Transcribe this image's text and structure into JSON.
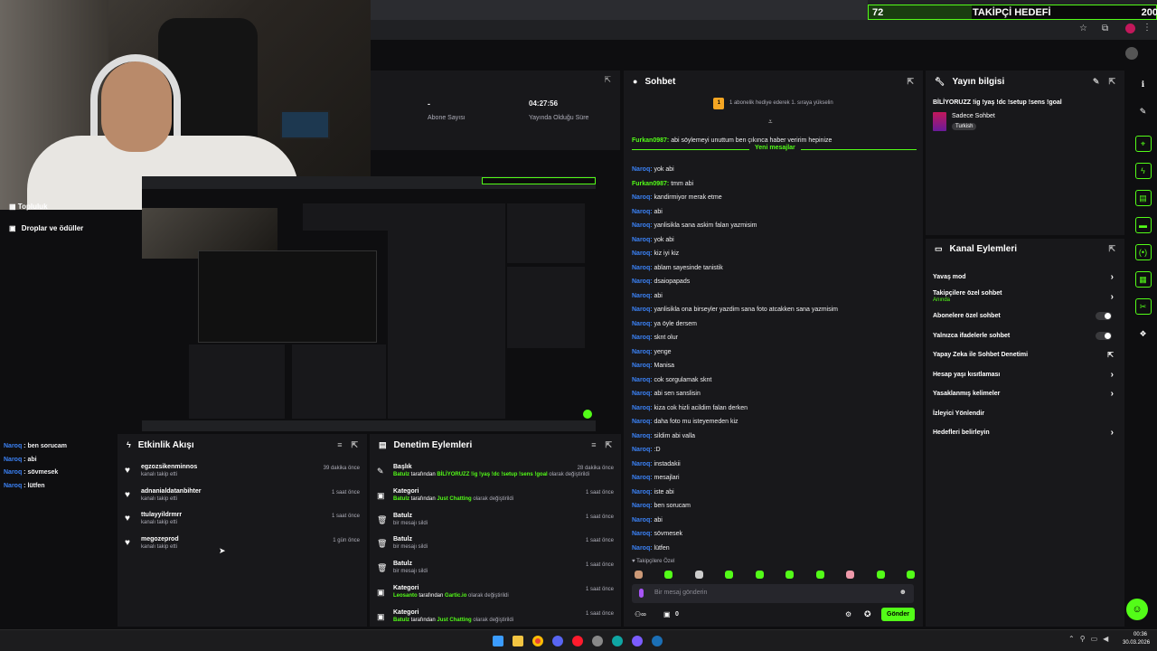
{
  "browser": {
    "progress_left": "72",
    "progress_title": "TAKİPÇİ HEDEFİ",
    "progress_right": "200",
    "progress_fraction": 0.36
  },
  "stats": {
    "dash": "-",
    "subscribers_label": "Abone Sayısı",
    "duration_value": "04:27:56",
    "duration_label": "Yayında Olduğu Süre"
  },
  "left_nav": {
    "item_partial": "Topluluk",
    "drops_label": "Droplar ve ödüller"
  },
  "overlay_chat": [
    {
      "user": "Naroq",
      "text": " : ben sorucam"
    },
    {
      "user": "Naroq",
      "text": " : abi"
    },
    {
      "user": "Naroq",
      "text": " : sövmesek"
    },
    {
      "user": "Naroq",
      "text": " : lütfen"
    }
  ],
  "chat": {
    "title": "Sohbet",
    "banner": "1 abonelik hediye ederek 1. sıraya yükselin",
    "banner_badge": "1",
    "pinned_user": "Furkan0987:",
    "pinned_text": " abi söylemeyi unuttum ben çıkınca haber veririm hepinize",
    "new_messages": "Yeni mesajlar",
    "messages": [
      {
        "user": "Naroq:",
        "text": " yok abi",
        "color": "blue"
      },
      {
        "user": "Furkan0987:",
        "text": " tmm abi",
        "color": "green"
      },
      {
        "user": "Naroq:",
        "text": " kandirmiyor merak etme",
        "color": "blue"
      },
      {
        "user": "Naroq:",
        "text": " abi",
        "color": "blue"
      },
      {
        "user": "Naroq:",
        "text": " yanlisikla sana askim falan yazmisim",
        "color": "blue"
      },
      {
        "user": "Naroq:",
        "text": " yok abi",
        "color": "blue"
      },
      {
        "user": "Naroq:",
        "text": " kiz iyi kiz",
        "color": "blue"
      },
      {
        "user": "Naroq:",
        "text": " ablam sayesinde tanistik",
        "color": "blue"
      },
      {
        "user": "Naroq:",
        "text": " dsaiopapads",
        "color": "blue"
      },
      {
        "user": "Naroq:",
        "text": " abi",
        "color": "blue"
      },
      {
        "user": "Naroq:",
        "text": " yanlisikla ona birseyler yazdim sana foto atcakken sana yazmisim",
        "color": "blue"
      },
      {
        "user": "Naroq:",
        "text": " ya öyle dersem",
        "color": "blue"
      },
      {
        "user": "Naroq:",
        "text": " sknt olur",
        "color": "blue"
      },
      {
        "user": "Naroq:",
        "text": " yenge",
        "color": "blue"
      },
      {
        "user": "Naroq:",
        "text": " Manisa",
        "color": "blue"
      },
      {
        "user": "Naroq:",
        "text": " cok sorgulamak sknt",
        "color": "blue"
      },
      {
        "user": "Naroq:",
        "text": " abi sen sanslisin",
        "color": "blue"
      },
      {
        "user": "Naroq:",
        "text": " kiza cok hizli acildim falan derken",
        "color": "blue"
      },
      {
        "user": "Naroq:",
        "text": " daha foto mu isteyemeden kiz",
        "color": "blue"
      },
      {
        "user": "Naroq:",
        "text": " sildim abi valla",
        "color": "blue"
      },
      {
        "user": "Naroq:",
        "text": " :D",
        "color": "blue"
      },
      {
        "user": "Naroq:",
        "text": " instadakii",
        "color": "blue"
      },
      {
        "user": "Naroq:",
        "text": " mesajlari",
        "color": "blue"
      },
      {
        "user": "Naroq:",
        "text": " iste abi",
        "color": "blue"
      },
      {
        "user": "Naroq:",
        "text": " ben sorucam",
        "color": "blue"
      },
      {
        "user": "Naroq:",
        "text": " abi",
        "color": "blue"
      },
      {
        "user": "Naroq:",
        "text": " sövmesek",
        "color": "blue"
      },
      {
        "user": "Naroq:",
        "text": " lütfen",
        "color": "blue"
      }
    ],
    "followers_only": "Takipçilere Özel",
    "input_placeholder": "Bir mesaj gönderin",
    "count": "0",
    "send_label": "Gönder"
  },
  "stream_info": {
    "title": "Yayın bilgisi",
    "stream_title": "BİLİYORUZZ !ig !yaş !dc !setup !sens !goal",
    "category": "Sadece Sohbet",
    "language": "Turkish"
  },
  "channel_actions": {
    "title": "Kanal Eylemleri",
    "items": [
      {
        "label": "Yavaş mod",
        "control": "chevron",
        "sub": ""
      },
      {
        "label": "Takipçilere özel sohbet",
        "control": "chevron",
        "sub": "Anında"
      },
      {
        "label": "Abonelere özel sohbet",
        "control": "toggle",
        "sub": ""
      },
      {
        "label": "Yalnızca ifadelerle sohbet",
        "control": "toggle",
        "sub": ""
      },
      {
        "label": "Yapay Zeka ile Sohbet Denetimi",
        "control": "external",
        "sub": ""
      },
      {
        "label": "Hesap yaşı kısıtlaması",
        "control": "chevron",
        "sub": ""
      },
      {
        "label": "Yasaklanmış kelimeler",
        "control": "chevron",
        "sub": ""
      },
      {
        "label": "İzleyici Yönlendir",
        "control": "none",
        "sub": ""
      },
      {
        "label": "Hedefleri belirleyin",
        "control": "chevron",
        "sub": ""
      }
    ]
  },
  "activity": {
    "title": "Etkinlik Akışı",
    "items": [
      {
        "name": "egzozsikenminnos",
        "desc": "kanalı takip etti",
        "time": "39 dakika önce"
      },
      {
        "name": "adnanialdatanbihter",
        "desc": "kanalı takip etti",
        "time": "1 saat önce"
      },
      {
        "name": "ttulayyildrmrr",
        "desc": "kanalı takip etti",
        "time": "1 saat önce"
      },
      {
        "name": "megozeprod",
        "desc": "kanalı takip etti",
        "time": "1 gün önce"
      }
    ]
  },
  "moderation": {
    "title": "Denetim Eylemleri",
    "items": [
      {
        "icon": "pencil",
        "title": "Başlık",
        "actor": "Batulz",
        "mid": " tarafından ",
        "target": "BİLİYORUZZ !ig !yaş !dc !setup !sens !goal",
        "end": " olarak değiştirildi",
        "time": "28 dakika önce"
      },
      {
        "icon": "category",
        "title": "Kategori",
        "actor": "Batulz",
        "mid": " tarafından ",
        "target": "Just Chatting",
        "end": " olarak değiştirildi",
        "time": "1 saat önce"
      },
      {
        "icon": "trash",
        "title": "Batulz",
        "actor": "",
        "mid": "bir mesajı sildi",
        "target": "",
        "end": "",
        "time": "1 saat önce"
      },
      {
        "icon": "trash",
        "title": "Batulz",
        "actor": "",
        "mid": "bir mesajı sildi",
        "target": "",
        "end": "",
        "time": "1 saat önce"
      },
      {
        "icon": "trash",
        "title": "Batulz",
        "actor": "",
        "mid": "bir mesajı sildi",
        "target": "",
        "end": "",
        "time": "1 saat önce"
      },
      {
        "icon": "category",
        "title": "Kategori",
        "actor": "Leosanto",
        "mid": " tarafından ",
        "target": "Gartic.io",
        "end": " olarak değiştirildi",
        "time": "1 saat önce"
      },
      {
        "icon": "category",
        "title": "Kategori",
        "actor": "Batulz",
        "mid": " tarafından ",
        "target": "Just Chatting",
        "end": " olarak değiştirildi",
        "time": "1 saat önce"
      }
    ]
  },
  "taskbar": {
    "time": "00:36",
    "date": "30.03.2026"
  },
  "colors": {
    "accent": "#53fc18",
    "bg": "#0e0e10",
    "panel": "#18181b",
    "user_blue": "#3b82f6"
  }
}
